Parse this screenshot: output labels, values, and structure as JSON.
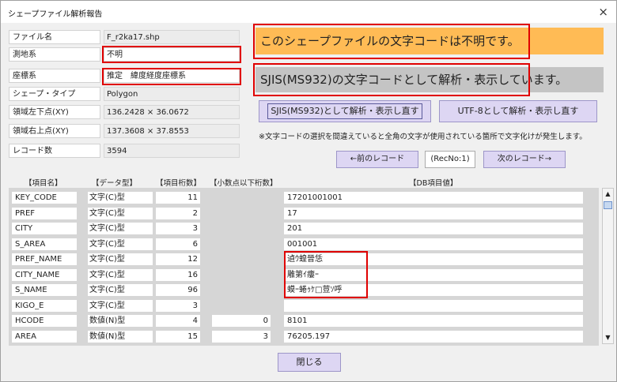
{
  "window": {
    "title": "シェープファイル解析報告",
    "close_symbol": "×"
  },
  "info": [
    {
      "label": "ファイル名",
      "value": "F_r2ka17.shp"
    },
    {
      "label": "測地系",
      "value": "不明"
    },
    {
      "label": "座標系",
      "value": "推定　緯度経度座標系"
    },
    {
      "label": "シェープ・タイプ",
      "value": "Polygon"
    },
    {
      "label": "領域左下点(XY)",
      "value": "136.2428 × 36.0672"
    },
    {
      "label": "領域右上点(XY)",
      "value": "137.3608 × 37.8553"
    },
    {
      "label": "レコード数",
      "value": "3594"
    }
  ],
  "banners": {
    "unknown": "このシェープファイルの文字コードは不明です。",
    "analyzing": "SJIS(MS932)の文字コードとして解析・表示しています。"
  },
  "buttons": {
    "reparse_sjis": "SJIS(MS932)として解析・表示し直す",
    "reparse_utf8": "UTF-8として解析・表示し直す",
    "prev": "←前のレコード",
    "recno": "(RecNo:1)",
    "next": "次のレコード→",
    "close": "閉じる"
  },
  "note": "※文字コードの選択を間違えていると全角の文字が使用されている箇所で文字化けが発生します。",
  "table": {
    "headers": [
      "【項目名】",
      "【データ型】",
      "【項目桁数】",
      "【小数点以下桁数】",
      "【DB項目値】"
    ],
    "rows": [
      {
        "name": "KEY_CODE",
        "type": "文字(C)型",
        "digits": "11",
        "decimals": "",
        "value": "17201001001"
      },
      {
        "name": "PREF",
        "type": "文字(C)型",
        "digits": "2",
        "decimals": "",
        "value": "17"
      },
      {
        "name": "CITY",
        "type": "文字(C)型",
        "digits": "3",
        "decimals": "",
        "value": "201"
      },
      {
        "name": "S_AREA",
        "type": "文字(C)型",
        "digits": "6",
        "decimals": "",
        "value": "001001"
      },
      {
        "name": "PREF_NAME",
        "type": "文字(C)型",
        "digits": "12",
        "decimals": "",
        "value": "遉ｳ蝗晉恁"
      },
      {
        "name": "CITY_NAME",
        "type": "文字(C)型",
        "digits": "16",
        "decimals": "",
        "value": "雕第ｲ瘻ｰ"
      },
      {
        "name": "S_NAME",
        "type": "文字(C)型",
        "digits": "96",
        "decimals": "",
        "value": "蟆ｰ蜷ｩｹ□荳ｿ呼"
      },
      {
        "name": "KIGO_E",
        "type": "文字(C)型",
        "digits": "3",
        "decimals": "",
        "value": ""
      },
      {
        "name": "HCODE",
        "type": "数値(N)型",
        "digits": "4",
        "decimals": "0",
        "value": "8101"
      },
      {
        "name": "AREA",
        "type": "数値(N)型",
        "digits": "15",
        "decimals": "3",
        "value": "76205.197"
      }
    ]
  },
  "colors": {
    "banner_unknown": "#ffbb55",
    "banner_analyzing": "#c4c4c4",
    "button_bg": "#ddd6f3",
    "highlight": "#e00000"
  },
  "icons": [
    "close-icon",
    "scroll-up-icon",
    "scroll-down-icon"
  ]
}
